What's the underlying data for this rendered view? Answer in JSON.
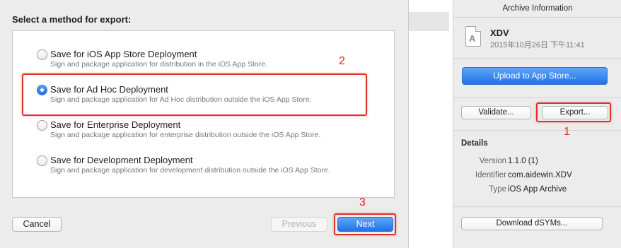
{
  "export_sheet": {
    "title": "Select a method for export:",
    "options": [
      {
        "label": "Save for iOS App Store Deployment",
        "description": "Sign and package application for distribution in the iOS App Store.",
        "selected": false
      },
      {
        "label": "Save for Ad Hoc Deployment",
        "description": "Sign and package application for Ad Hoc distribution outside the iOS App Store.",
        "selected": true
      },
      {
        "label": "Save for Enterprise Deployment",
        "description": "Sign and package application for enterprise distribution outside the iOS App Store.",
        "selected": false
      },
      {
        "label": "Save for Development Deployment",
        "description": "Sign and package application for development distribution outside the iOS App Store.",
        "selected": false
      }
    ],
    "cancel_label": "Cancel",
    "previous_label": "Previous",
    "next_label": "Next"
  },
  "archive_panel": {
    "header": "Archive Information",
    "app_name": "XDV",
    "date": "2015年10月26日 下午11:41",
    "upload_label": "Upload to App Store...",
    "validate_label": "Validate...",
    "export_label": "Export...",
    "details_title": "Details",
    "details": [
      {
        "label": "Version",
        "value": "1.1.0 (1)"
      },
      {
        "label": "Identifier",
        "value": "com.aidewin.XDV"
      },
      {
        "label": "Type",
        "value": "iOS App Archive"
      }
    ],
    "download_label": "Download dSYMs..."
  },
  "annotations": {
    "step1": "1",
    "step2": "2",
    "step3": "3"
  },
  "colors": {
    "accent_blue": "#2173e8",
    "annotation_red": "#e0322b"
  }
}
